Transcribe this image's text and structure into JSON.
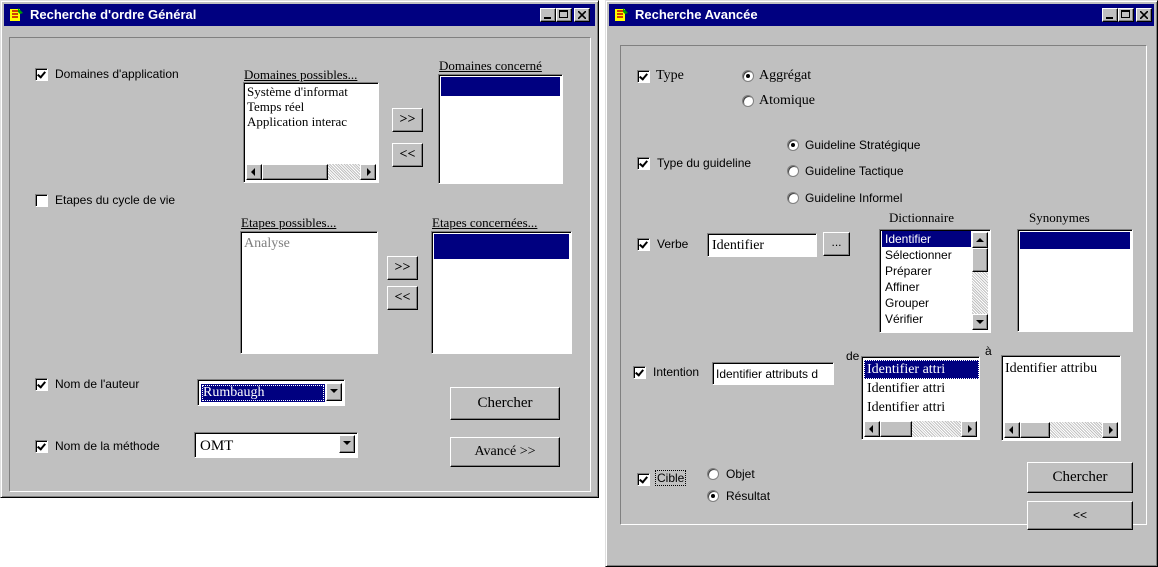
{
  "win1": {
    "title": "Recherche d'ordre Général",
    "domaines": {
      "checkbox_label": "Domaines d'application",
      "checked": true,
      "possible_header": "Domaines possibles...",
      "possible_items": [
        "Système d'informat",
        "Temps réel",
        "Application interac"
      ],
      "concerned_header": "Domaines concerné",
      "add_label": ">>",
      "remove_label": "<<"
    },
    "etapes": {
      "checkbox_label": "Etapes du cycle de vie",
      "checked": false,
      "possible_header": "Etapes possibles...",
      "possible_items": [
        "Analyse"
      ],
      "concerned_header": "Etapes concernées...",
      "add_label": ">>",
      "remove_label": "<<"
    },
    "auteur": {
      "checkbox_label": "Nom de l'auteur",
      "checked": true,
      "value": "Rumbaugh"
    },
    "methode": {
      "checkbox_label": "Nom de la méthode",
      "checked": true,
      "value": "OMT"
    },
    "chercher_label": "Chercher",
    "avance_label": "Avancé >>"
  },
  "win2": {
    "title": "Recherche Avancée",
    "type": {
      "checkbox_label": "Type",
      "checked": true,
      "options": [
        "Aggrégat",
        "Atomique"
      ],
      "selected": "Aggrégat"
    },
    "type_guideline": {
      "checkbox_label": "Type du guideline",
      "checked": true,
      "options": [
        "Guideline Stratégique",
        "Guideline Tactique",
        "Guideline Informel"
      ],
      "selected": "Guideline Stratégique"
    },
    "verbe": {
      "checkbox_label": "Verbe",
      "checked": true,
      "value": "Identifier",
      "browse_label": "...",
      "dictionnaire_header": "Dictionnaire",
      "dictionnaire_items": [
        "Identifier",
        "Sélectionner",
        "Préparer",
        "Affiner",
        "Grouper",
        "Vérifier"
      ],
      "synonymes_header": "Synonymes"
    },
    "intention": {
      "checkbox_label": "Intention",
      "checked": true,
      "value": "Identifier attributs d",
      "de_label": "de",
      "a_label": "à",
      "de_items": [
        "Identifier attri",
        "Identifier attri",
        "Identifier attri"
      ],
      "a_items": [
        "Identifier attribu"
      ]
    },
    "cible": {
      "checkbox_label": "Cible",
      "checked": true,
      "options": [
        "Objet",
        "Résultat"
      ],
      "selected": "Résultat"
    },
    "chercher_label": "Chercher",
    "back_label": "<<"
  }
}
